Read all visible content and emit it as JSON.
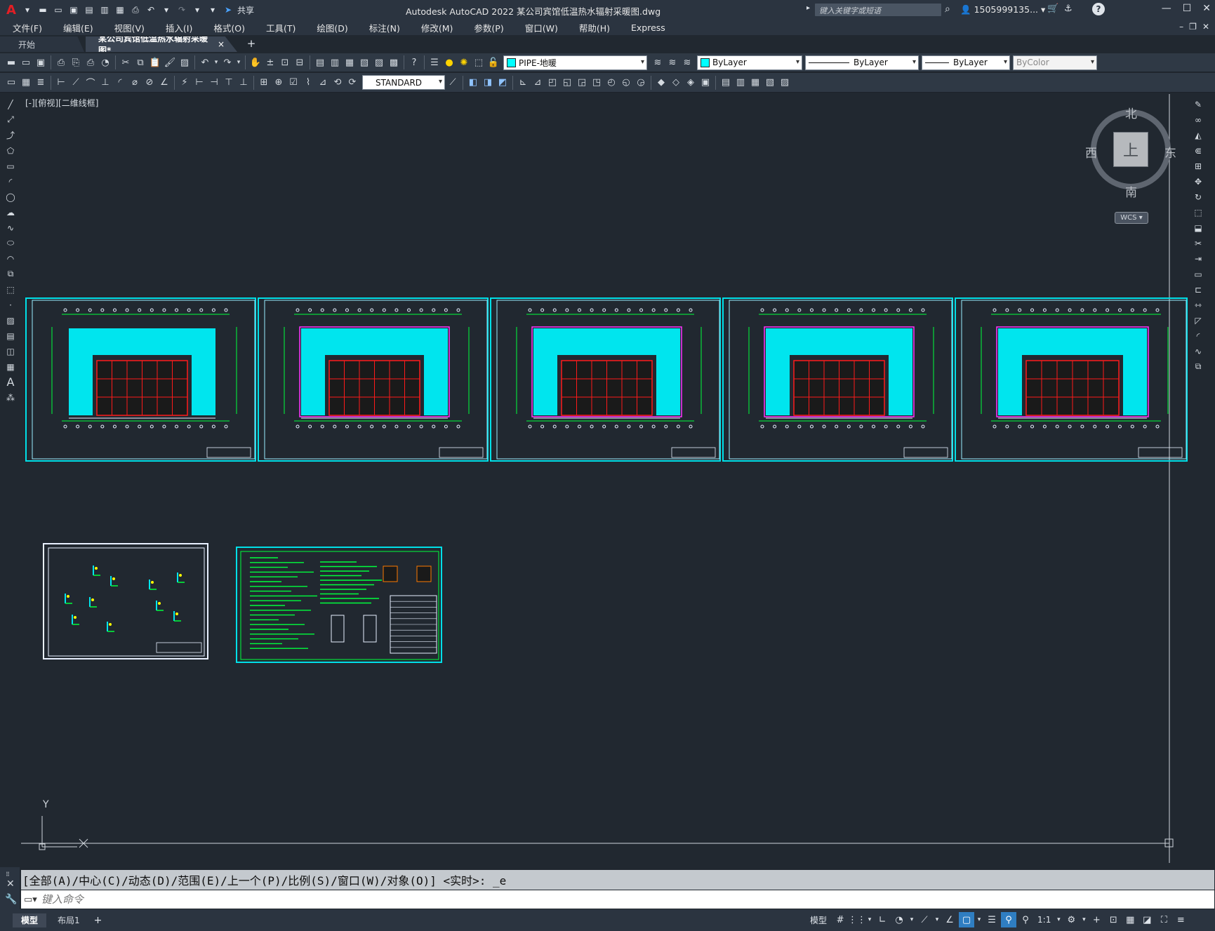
{
  "app": {
    "title": "Autodesk AutoCAD 2022 某公司宾馆低温热水辐射采暖图.dwg",
    "logo": "A",
    "share": "共享",
    "search_placeholder": "键入关键字或短语",
    "user": "1505999135...",
    "help": "?"
  },
  "menu": [
    "文件(F)",
    "编辑(E)",
    "视图(V)",
    "插入(I)",
    "格式(O)",
    "工具(T)",
    "绘图(D)",
    "标注(N)",
    "修改(M)",
    "参数(P)",
    "窗口(W)",
    "帮助(H)",
    "Express"
  ],
  "tabs": [
    {
      "label": "开始",
      "active": false
    },
    {
      "label": "某公司宾馆低温热水辐射采暖图*",
      "active": true
    }
  ],
  "tab_close": "×",
  "tab_add": "+",
  "layer": {
    "name": "PIPE-地暖",
    "color": "#00ffff"
  },
  "properties": {
    "color": "ByLayer",
    "linetype": "ByLayer",
    "lineweight": "ByLayer",
    "plotstyle": "ByColor"
  },
  "textstyle": "STANDARD",
  "viewport_label": "[-][俯视][二维线框]",
  "viewcube": {
    "north": "北",
    "south": "南",
    "east": "东",
    "west": "西",
    "face": "上",
    "wcs": "WCS"
  },
  "ucs": {
    "y": "Y",
    "x": "X"
  },
  "command": {
    "history": "[全部(A)/中心(C)/动态(D)/范围(E)/上一个(P)/比例(S)/窗口(W)/对象(O)] <实时>: _e",
    "placeholder": "键入命令"
  },
  "layouts": [
    {
      "label": "模型",
      "active": true
    },
    {
      "label": "布局1",
      "active": false
    }
  ],
  "status": {
    "model": "模型",
    "scale": "1:1"
  },
  "icons": {
    "new": "new-file-icon",
    "open": "open-folder-icon",
    "save": "save-icon",
    "undo": "undo-icon",
    "redo": "redo-icon",
    "pan": "pan-hand-icon",
    "zoom": "zoom-icon",
    "line": "line-icon",
    "circle": "circle-icon",
    "text": "text-icon",
    "move": "move-icon",
    "gear": "gear-icon"
  }
}
